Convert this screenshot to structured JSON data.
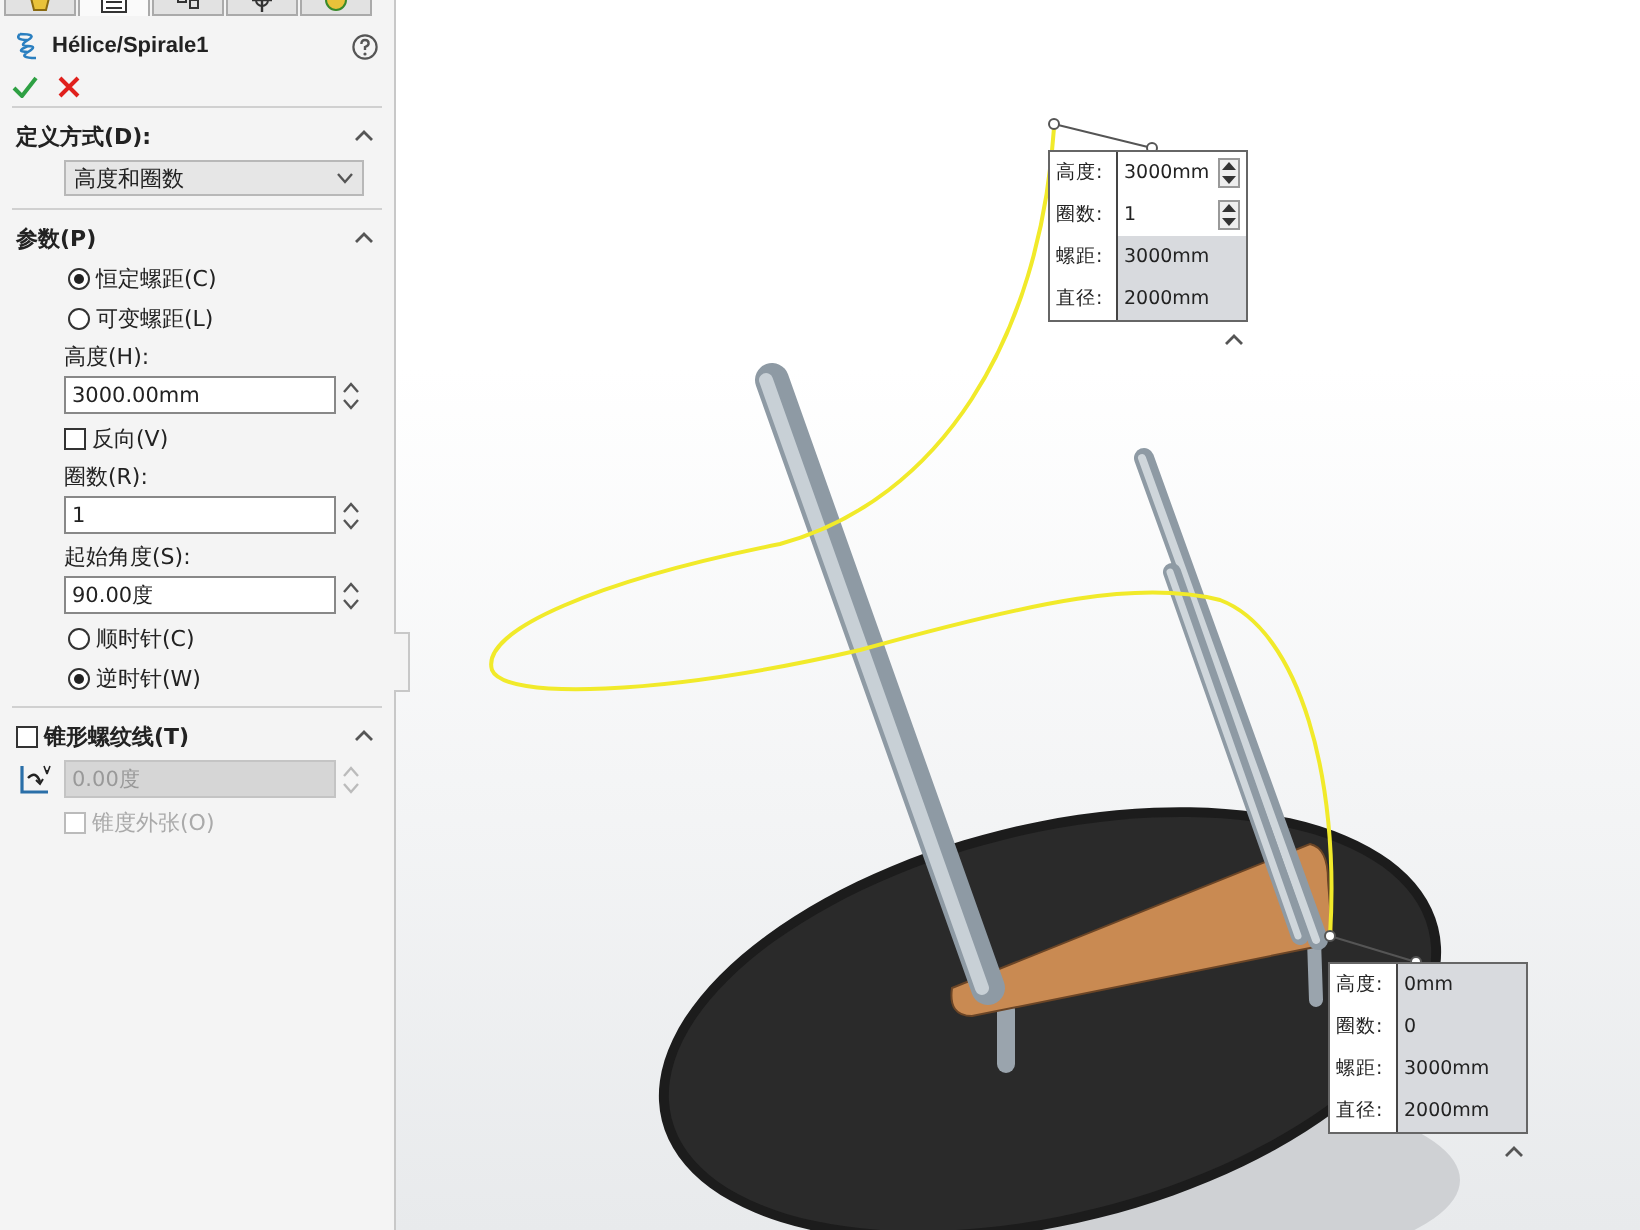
{
  "tabs": [
    {
      "selected": false
    },
    {
      "selected": true
    },
    {
      "selected": false
    },
    {
      "selected": false
    },
    {
      "selected": false
    }
  ],
  "feature": {
    "title": "Hélice/Spirale1"
  },
  "sections": [
    {
      "title": "定义方式(D):",
      "items": [
        {
          "kind": "dropdown",
          "value": "高度和圈数"
        }
      ]
    },
    {
      "title": "参数(P)",
      "items": [
        {
          "kind": "radio",
          "label": "恒定螺距(C)",
          "selected": true
        },
        {
          "kind": "radio",
          "label": "可变螺距(L)",
          "selected": false
        },
        {
          "kind": "field",
          "label": "高度(H):",
          "value": "3000.00mm",
          "disabled": false
        },
        {
          "kind": "checkbox",
          "label": "反向(V)",
          "checked": false,
          "disabled": false
        },
        {
          "kind": "field",
          "label": "圈数(R):",
          "value": "1",
          "disabled": false
        },
        {
          "kind": "field",
          "label": "起始角度(S):",
          "value": "90.00度",
          "disabled": false
        },
        {
          "kind": "radio",
          "label": "顺时针(C)",
          "selected": false
        },
        {
          "kind": "radio",
          "label": "逆时针(W)",
          "selected": true
        }
      ]
    },
    {
      "title": "锥形螺纹线(T)",
      "checked": false,
      "items": [
        {
          "kind": "angle-field",
          "value": "0.00度",
          "disabled": true
        },
        {
          "kind": "checkbox",
          "label": "锥度外张(O)",
          "checked": false,
          "disabled": true
        }
      ]
    }
  ],
  "callouts": [
    {
      "rows": [
        {
          "label": "高度:",
          "value": "3000mm",
          "editable": true
        },
        {
          "label": "圈数:",
          "value": "1",
          "editable": true
        },
        {
          "label": "螺距:",
          "value": "3000mm",
          "editable": false
        },
        {
          "label": "直径:",
          "value": "2000mm",
          "editable": false
        }
      ]
    },
    {
      "rows": [
        {
          "label": "高度:",
          "value": "0mm",
          "editable": false
        },
        {
          "label": "圈数:",
          "value": "0",
          "editable": false
        },
        {
          "label": "螺距:",
          "value": "3000mm",
          "editable": false
        },
        {
          "label": "直径:",
          "value": "2000mm",
          "editable": false
        }
      ]
    }
  ]
}
